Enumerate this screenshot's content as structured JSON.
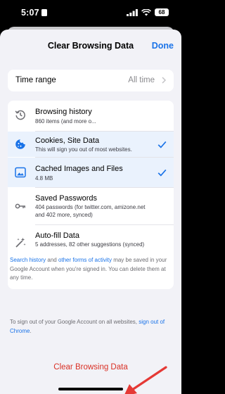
{
  "status_bar": {
    "time": "5:07",
    "battery": "68",
    "icons": [
      "contact-card-icon",
      "signal-icon",
      "wifi-icon",
      "battery-icon"
    ]
  },
  "nav": {
    "title": "Clear Browsing Data",
    "done_label": "Done"
  },
  "time_range": {
    "label": "Time range",
    "value": "All time"
  },
  "items": [
    {
      "title": "Browsing history",
      "subtitle": "860 items (and more o...",
      "icon": "history-icon",
      "selected": false
    },
    {
      "title": "Cookies, Site Data",
      "subtitle": "This will sign you out of most websites.",
      "icon": "cookie-icon",
      "selected": true
    },
    {
      "title": "Cached Images and Files",
      "subtitle": "4.8 MB",
      "icon": "image-icon",
      "selected": true
    },
    {
      "title": "Saved Passwords",
      "subtitle": "404 passwords (for twitter.com, amizone.net and 402 more, synced)",
      "icon": "key-icon",
      "selected": false
    },
    {
      "title": "Auto-fill Data",
      "subtitle": "5 addresses, 82 other suggestions (synced)",
      "icon": "magic-wand-icon",
      "selected": false
    }
  ],
  "info": {
    "search_history_link": "Search history",
    "and_text": " and ",
    "other_activity_link": "other forms of activity",
    "rest_text": " may be saved in your Google Account when you're signed in. You can delete them at any time."
  },
  "signout": {
    "text": "To sign out of your Google Account on all websites, ",
    "link": "sign out of Chrome",
    "end": "."
  },
  "clear_button": "Clear Browsing Data",
  "colors": {
    "accent": "#1a73e8",
    "destructive": "#d93025",
    "annotation_arrow": "#e53935",
    "selected_row": "#eaf2fd"
  }
}
